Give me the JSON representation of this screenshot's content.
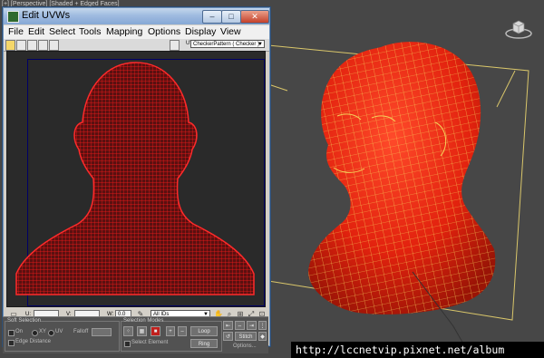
{
  "viewport": {
    "label": "[+] [Perspective] [Shaded + Edged Faces]",
    "mesh_color": "#e8230f",
    "wire_color": "#f5d35a",
    "gizmo_color": "#d9c66a"
  },
  "window": {
    "title": "Edit UVWs",
    "minimize": "–",
    "maximize": "□",
    "close": "✕"
  },
  "menu": [
    "File",
    "Edit",
    "Select",
    "Tools",
    "Mapping",
    "Options",
    "Display",
    "View"
  ],
  "toolbar": {
    "uv_label": "UV",
    "texture_dropdown": "CheckerPattern ( Checker )"
  },
  "uv_editor": {
    "background": "#2a2a2a",
    "uv_color": "#ff1a1a"
  },
  "bottom_bar": {
    "u_label": "U:",
    "v_label": "V:",
    "w_label": "W:",
    "w_value": "0.0",
    "id_dropdown": "All IDs"
  },
  "panels": {
    "soft_selection": {
      "title": "Soft Selection",
      "on_label": "On",
      "xy_label": "XY",
      "uv_label": "UV",
      "falloff_label": "Falloff",
      "edge_distance_label": "Edge Distance"
    },
    "selection_modes": {
      "title": "Selection Modes",
      "plus": "+",
      "minus": "–",
      "loop": "Loop",
      "ring": "Ring",
      "select_element": "Select Element"
    },
    "stitch": "Stitch",
    "options": "Options..."
  },
  "watermark": "http://lccnetvip.pixnet.net/album"
}
